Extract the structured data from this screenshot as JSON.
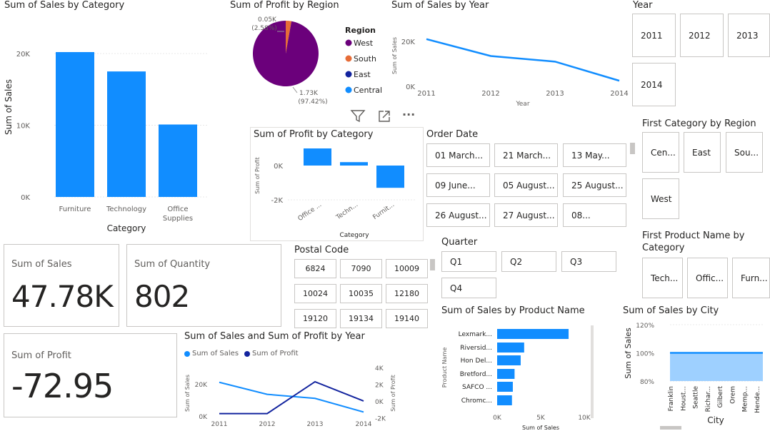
{
  "sales_by_category": {
    "title": "Sum of Sales by Category",
    "chart_data": {
      "type": "bar",
      "title": "Sum of Sales by Category",
      "categories": [
        "Furniture",
        "Technology",
        "Office Supplies"
      ],
      "values": [
        20200,
        17500,
        10100
      ],
      "xlabel": "Category",
      "ylabel": "Sum of Sales",
      "ylim": [
        0,
        25000
      ],
      "yticks": [
        "0K",
        "10K",
        "20K"
      ],
      "color": "#118DFF"
    }
  },
  "profit_by_region": {
    "title": "Sum of Profit by Region",
    "legend_title": "Region",
    "legend": [
      {
        "label": "West",
        "color": "#6B007B"
      },
      {
        "label": "South",
        "color": "#E66C37"
      },
      {
        "label": "East",
        "color": "#12239E"
      },
      {
        "label": "Central",
        "color": "#118DFF"
      }
    ],
    "label_small": "0.05K",
    "label_small_pct": "(2.58%)",
    "label_large": "1.73K",
    "label_large_pct": "(97.42%)",
    "chart_data": {
      "type": "pie",
      "title": "Sum of Profit by Region",
      "categories": [
        "West",
        "South"
      ],
      "values": [
        1.73,
        0.05
      ],
      "percents": [
        97.42,
        2.58
      ],
      "colors": [
        "#6B007B",
        "#E66C37"
      ]
    }
  },
  "sales_by_year": {
    "title": "Sum of Sales by Year",
    "chart_data": {
      "type": "line",
      "title": "Sum of Sales by Year",
      "x": [
        "2011",
        "2012",
        "2013",
        "2014"
      ],
      "values": [
        21000,
        13500,
        11000,
        2500
      ],
      "xlabel": "Year",
      "ylabel": "Sum of Sales",
      "ylim": [
        0,
        25000
      ],
      "yticks": [
        "0K",
        "20K"
      ],
      "color": "#118DFF"
    }
  },
  "year_slicer": {
    "title": "Year",
    "items": [
      "2011",
      "2012",
      "2013",
      "2014"
    ]
  },
  "visual_header": {
    "filter_icon": "filter-icon",
    "focus_icon": "focus-mode-icon",
    "more_icon": "more-options-icon",
    "more_label": "···"
  },
  "profit_by_category": {
    "title": "Sum of Profit by Category",
    "chart_data": {
      "type": "bar",
      "title": "Sum of Profit by Category",
      "categories": [
        "Office ...",
        "Techn...",
        "Furnit..."
      ],
      "values": [
        1000,
        200,
        -1300
      ],
      "xlabel": "Category",
      "ylabel": "Sum of Profit",
      "ylim": [
        -2500,
        1500
      ],
      "yticks": [
        "-2K",
        "0K"
      ],
      "color": "#118DFF"
    }
  },
  "order_date_slicer": {
    "title": "Order Date",
    "items": [
      "01 March...",
      "21 March...",
      "13 May...",
      "09 June...",
      "05 August...",
      "25 August...",
      "26 August...",
      "27 August...",
      "08..."
    ]
  },
  "first_category_by_region": {
    "title": "First Category by Region",
    "items": [
      "Cen...",
      "East",
      "Sou...",
      "West"
    ]
  },
  "kpi_sales": {
    "label": "Sum of Sales",
    "value": "47.78K"
  },
  "kpi_quantity": {
    "label": "Sum of Quantity",
    "value": "802"
  },
  "kpi_profit": {
    "label": "Sum of Profit",
    "value": "-72.95"
  },
  "postal_code_slicer": {
    "title": "Postal Code",
    "items": [
      "6824",
      "7090",
      "10009",
      "10024",
      "10035",
      "12180",
      "19120",
      "19134",
      "19140"
    ]
  },
  "quarter_slicer": {
    "title": "Quarter",
    "items": [
      "Q1",
      "Q2",
      "Q3",
      "Q4"
    ]
  },
  "first_product_by_category": {
    "title": "First Product Name by Category",
    "title_line1": "First Product Name by",
    "title_line2": "Category",
    "items": [
      "Tech...",
      "Offic...",
      "Furn..."
    ]
  },
  "sales_profit_by_year": {
    "title": "Sum of Sales and Sum of Profit by Year",
    "legend": [
      {
        "label": "Sum of Sales",
        "color": "#118DFF"
      },
      {
        "label": "Sum of Profit",
        "color": "#12239E"
      }
    ],
    "chart_data": {
      "type": "line",
      "title": "Sum of Sales and Sum of Profit by Year",
      "x": [
        "2011",
        "2012",
        "2013",
        "2014"
      ],
      "series": [
        {
          "name": "Sum of Sales",
          "values": [
            21000,
            13500,
            11000,
            2500
          ],
          "axis": "left",
          "color": "#118DFF"
        },
        {
          "name": "Sum of Profit",
          "values": [
            -1500,
            -1500,
            2300,
            0
          ],
          "axis": "right",
          "color": "#12239E"
        }
      ],
      "ylabel": "Sum of Sales",
      "y2label": "Sum of Profit",
      "ylim": [
        0,
        28000
      ],
      "y2lim": [
        -2000,
        4000
      ],
      "yticks": [
        "0K",
        "20K"
      ],
      "y2ticks": [
        "-2K",
        "0K",
        "2K",
        "4K"
      ]
    }
  },
  "sales_by_product": {
    "title": "Sum of Sales by Product Name",
    "chart_data": {
      "type": "bar",
      "orientation": "horizontal",
      "title": "Sum of Sales by Product Name",
      "categories": [
        "Lexmark...",
        "Riversid...",
        "Hon Del...",
        "Bretford...",
        "SAFCO ...",
        "Chromc..."
      ],
      "values": [
        8200,
        3100,
        2700,
        2000,
        1800,
        1700
      ],
      "xlabel": "Sum of Sales",
      "ylabel": "Product Name",
      "xlim": [
        0,
        10000
      ],
      "xticks": [
        "0K",
        "5K",
        "10K"
      ],
      "color": "#118DFF"
    }
  },
  "sales_by_city": {
    "title": "Sum of Sales by City",
    "chart_data": {
      "type": "area",
      "title": "Sum of Sales by City",
      "categories": [
        "Franklin",
        "Houst...",
        "Seattle",
        "Richar...",
        "Gilbert",
        "Orem",
        "Memp...",
        "Hende..."
      ],
      "values": [
        100,
        100,
        100,
        100,
        100,
        100,
        100,
        100
      ],
      "xlabel": "City",
      "ylabel": "Sum of Sales",
      "ylim": [
        80,
        120
      ],
      "yticks": [
        "80%",
        "100%",
        "120%"
      ],
      "color": "#118DFF",
      "fill": "#9ED0FF"
    }
  }
}
